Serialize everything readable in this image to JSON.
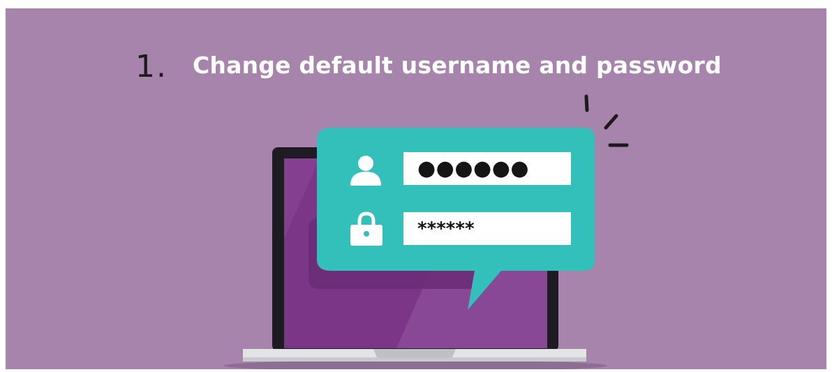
{
  "header": {
    "step_number": "1.",
    "title": "Change default username and password"
  },
  "login_card": {
    "username_value": "●●●●●●",
    "password_value": "******"
  },
  "icons": [
    "user-icon",
    "lock-icon",
    "laptop-icon",
    "attention-lines-icon"
  ],
  "colors": {
    "background": "#a784ab",
    "card": "#33bfba",
    "screen": "#7b3688",
    "laptop_frame": "#1f1b24",
    "laptop_base": "#e3e4e6"
  }
}
